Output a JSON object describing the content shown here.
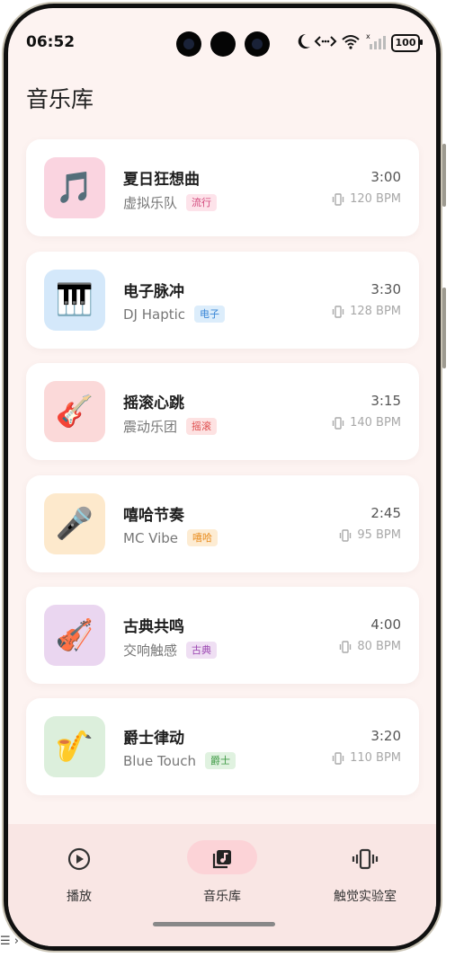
{
  "status_bar": {
    "time": "06:52",
    "battery": "100"
  },
  "page_title": "音乐库",
  "songs": [
    {
      "title": "夏日狂想曲",
      "artist": "虚拟乐队",
      "genre": "流行",
      "duration": "3:00",
      "bpm": "120 BPM",
      "icon": "musical-note-icon",
      "glyph": "🎵",
      "thumb_color": "#fad4e0",
      "genre_bg": "#fde3ea",
      "genre_fg": "#d2457a"
    },
    {
      "title": "电子脉冲",
      "artist": "DJ Haptic",
      "genre": "电子",
      "duration": "3:30",
      "bpm": "128 BPM",
      "icon": "piano-icon",
      "glyph": "🎹",
      "thumb_color": "#d4e8fa",
      "genre_bg": "#dcedfb",
      "genre_fg": "#3a86d6"
    },
    {
      "title": "摇滚心跳",
      "artist": "震动乐团",
      "genre": "摇滚",
      "duration": "3:15",
      "bpm": "140 BPM",
      "icon": "guitar-icon",
      "glyph": "🎸",
      "thumb_color": "#fbd9d9",
      "genre_bg": "#fde2e2",
      "genre_fg": "#de4b4b"
    },
    {
      "title": "嘻哈节奏",
      "artist": "MC Vibe",
      "genre": "嘻哈",
      "duration": "2:45",
      "bpm": "95 BPM",
      "icon": "microphone-icon",
      "glyph": "🎤",
      "thumb_color": "#fde9cc",
      "genre_bg": "#fdecd3",
      "genre_fg": "#e88a1a"
    },
    {
      "title": "古典共鸣",
      "artist": "交响触感",
      "genre": "古典",
      "duration": "4:00",
      "bpm": "80 BPM",
      "icon": "violin-icon",
      "glyph": "🎻",
      "thumb_color": "#ead6f0",
      "genre_bg": "#efdff3",
      "genre_fg": "#9a44b0"
    },
    {
      "title": "爵士律动",
      "artist": "Blue Touch",
      "genre": "爵士",
      "duration": "3:20",
      "bpm": "110 BPM",
      "icon": "saxophone-icon",
      "glyph": "🎷",
      "thumb_color": "#dcefdc",
      "genre_bg": "#e0f2e0",
      "genre_fg": "#3f9a45"
    }
  ],
  "tabs": [
    {
      "label": "播放",
      "icon": "play-circle-icon"
    },
    {
      "label": "音乐库",
      "icon": "music-library-icon",
      "active": true
    },
    {
      "label": "触觉实验室",
      "icon": "vibration-icon"
    }
  ],
  "colors": {
    "background": "#fdf3f1",
    "tabbar": "#f9e6e4",
    "active_pill": "#fcd3d7"
  }
}
